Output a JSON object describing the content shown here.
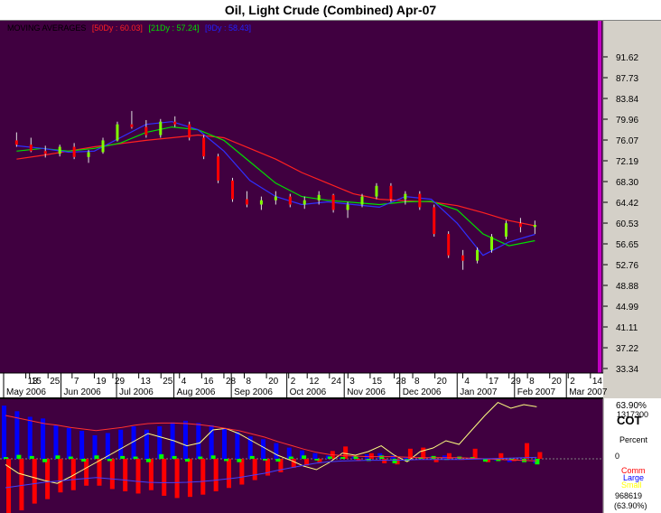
{
  "title": "Oil, Light Crude (Combined) Apr-07",
  "legend": {
    "label": "MOVING AVERAGES",
    "ma50": "[50Dy : 60.03]",
    "ma21": "[21Dy : 57.24]",
    "ma9": "[9Dy : 58.43]"
  },
  "colors": {
    "background": "#400040",
    "up_candle": "#80ff00",
    "down_candle": "#ff0000",
    "ma50": "#ff2020",
    "ma21": "#00e000",
    "ma9": "#3030ff",
    "cot_line": "#ffff80",
    "cot_bar_pos": "#0000ff",
    "cot_bar_neg": "#ff0000",
    "cot_bar_small": "#00ff00"
  },
  "x_ticks": [
    "13",
    "15",
    "25",
    "7",
    "19",
    "29",
    "13",
    "25",
    "4",
    "16",
    "28",
    "8",
    "20",
    "2",
    "12",
    "24",
    "3",
    "15",
    "28",
    "8",
    "20",
    "4",
    "17",
    "29",
    "8",
    "20",
    "2",
    "14"
  ],
  "month_labels": [
    "May 2006",
    "Jun 2006",
    "Jul 2006",
    "Aug 2006",
    "Sep 2006",
    "Oct 2006",
    "Nov 2006",
    "Dec 2006",
    "Jan 2007",
    "Feb 2007",
    "Mar 2007"
  ],
  "lower_panel": {
    "top_pct": "63.90%",
    "top_value": "1317300",
    "name": "COT",
    "unit": "Percent",
    "zero_label": "0",
    "legend_comm": "Comm",
    "legend_large": "Large",
    "legend_small": "Small",
    "bottom_value": "968619",
    "bottom_pct": "(63.90%)"
  },
  "chart_data": {
    "type": "line",
    "title": "Oil, Light Crude (Combined) Apr-07",
    "ylim": [
      33.34,
      95.5
    ],
    "y_ticks": [
      "91.62",
      "87.73",
      "83.84",
      "79.96",
      "76.07",
      "72.19",
      "68.30",
      "64.42",
      "60.53",
      "56.65",
      "52.76",
      "48.88",
      "44.99",
      "41.11",
      "37.22",
      "33.34"
    ],
    "x": [
      "2006-05-08",
      "2006-05-22",
      "2006-06-05",
      "2006-06-19",
      "2006-07-03",
      "2006-07-17",
      "2006-07-31",
      "2006-08-14",
      "2006-08-28",
      "2006-09-11",
      "2006-09-25",
      "2006-10-09",
      "2006-10-23",
      "2006-11-06",
      "2006-11-20",
      "2006-12-04",
      "2006-12-18",
      "2007-01-01",
      "2007-01-15",
      "2007-01-29",
      "2007-02-12"
    ],
    "series": [
      {
        "name": "50Dy",
        "values": [
          72.5,
          73.2,
          74.0,
          74.8,
          75.4,
          76.0,
          76.5,
          77.0,
          76.5,
          74.5,
          72.5,
          70.0,
          68.0,
          66.0,
          65.0,
          64.7,
          64.5,
          63.8,
          62.5,
          61.0,
          60.03
        ]
      },
      {
        "name": "21Dy",
        "values": [
          74.0,
          74.5,
          74.0,
          74.5,
          75.5,
          77.5,
          78.5,
          78.0,
          76.0,
          72.0,
          68.0,
          65.5,
          64.8,
          64.4,
          64.0,
          64.5,
          64.6,
          63.0,
          58.5,
          56.3,
          57.24
        ]
      },
      {
        "name": "9Dy",
        "values": [
          75.0,
          74.5,
          73.8,
          74.0,
          76.5,
          79.0,
          79.5,
          78.0,
          74.0,
          68.5,
          65.5,
          64.0,
          64.5,
          64.0,
          63.5,
          65.5,
          65.0,
          60.5,
          54.5,
          57.0,
          58.43
        ]
      }
    ],
    "ohlc": [
      [
        76.0,
        77.5,
        74.8,
        75.2
      ],
      [
        75.2,
        76.5,
        73.8,
        74.0
      ],
      [
        74.0,
        75.0,
        72.8,
        73.5
      ],
      [
        73.5,
        75.2,
        73.0,
        74.8
      ],
      [
        74.8,
        75.5,
        72.5,
        72.9
      ],
      [
        72.9,
        74.2,
        71.8,
        73.8
      ],
      [
        73.8,
        76.5,
        73.5,
        76.0
      ],
      [
        76.0,
        79.5,
        75.8,
        79.0
      ],
      [
        79.0,
        81.5,
        78.2,
        78.5
      ],
      [
        78.5,
        79.8,
        76.5,
        77.0
      ],
      [
        77.0,
        80.0,
        76.5,
        79.5
      ],
      [
        79.5,
        80.5,
        78.5,
        79.0
      ],
      [
        79.0,
        79.5,
        76.0,
        76.5
      ],
      [
        76.5,
        77.0,
        72.5,
        73.0
      ],
      [
        73.0,
        73.5,
        68.0,
        68.5
      ],
      [
        68.5,
        69.0,
        64.5,
        65.0
      ],
      [
        65.0,
        66.5,
        63.5,
        64.0
      ],
      [
        64.0,
        65.5,
        63.0,
        64.8
      ],
      [
        64.8,
        66.5,
        64.0,
        65.5
      ],
      [
        65.5,
        66.0,
        63.5,
        64.0
      ],
      [
        64.0,
        65.5,
        63.2,
        64.8
      ],
      [
        64.8,
        66.5,
        64.0,
        65.8
      ],
      [
        65.8,
        66.0,
        62.5,
        63.0
      ],
      [
        63.0,
        64.5,
        61.5,
        64.0
      ],
      [
        64.0,
        66.0,
        63.5,
        65.5
      ],
      [
        65.5,
        68.0,
        65.0,
        67.5
      ],
      [
        67.5,
        68.0,
        64.5,
        65.0
      ],
      [
        65.0,
        66.5,
        64.0,
        66.0
      ],
      [
        66.0,
        66.5,
        63.0,
        63.5
      ],
      [
        63.5,
        64.0,
        58.0,
        58.5
      ],
      [
        58.5,
        59.0,
        54.0,
        54.5
      ],
      [
        54.5,
        55.5,
        51.8,
        53.5
      ],
      [
        53.5,
        56.0,
        53.0,
        55.5
      ],
      [
        55.5,
        58.5,
        55.0,
        58.0
      ],
      [
        58.0,
        61.0,
        57.5,
        60.5
      ],
      [
        60.5,
        61.5,
        58.8,
        59.8
      ],
      [
        59.8,
        61.0,
        58.5,
        60.2
      ]
    ],
    "x_axis_start": "2006-05-01",
    "x_axis_end": "2007-03-17",
    "lower": {
      "type": "bar",
      "x": [
        "2006-05-02",
        "2006-05-09",
        "2006-05-16",
        "2006-05-23",
        "2006-05-30",
        "2006-06-06",
        "2006-06-13",
        "2006-06-20",
        "2006-06-27",
        "2006-07-04",
        "2006-07-11",
        "2006-07-18",
        "2006-07-25",
        "2006-08-01",
        "2006-08-08",
        "2006-08-15",
        "2006-08-22",
        "2006-08-29",
        "2006-09-05",
        "2006-09-12",
        "2006-09-19",
        "2006-09-26",
        "2006-10-03",
        "2006-10-10",
        "2006-10-17",
        "2006-10-24",
        "2006-10-31",
        "2006-11-07",
        "2006-11-14",
        "2006-11-21",
        "2006-11-28",
        "2006-12-05",
        "2006-12-12",
        "2006-12-19",
        "2006-12-26",
        "2007-01-02",
        "2007-01-09",
        "2007-01-16",
        "2007-01-23",
        "2007-01-30",
        "2007-02-06",
        "2007-02-13"
      ],
      "large": [
        95,
        85,
        75,
        72,
        60,
        55,
        50,
        42,
        46,
        52,
        58,
        52,
        58,
        65,
        68,
        64,
        60,
        55,
        48,
        40,
        35,
        28,
        20,
        15,
        10,
        6,
        2,
        5,
        8,
        10,
        6,
        2,
        0,
        4,
        6,
        3,
        2,
        0,
        -3,
        -6,
        -4,
        -8
      ],
      "comm": [
        -98,
        -92,
        -80,
        -72,
        -60,
        -56,
        -48,
        -48,
        -54,
        -58,
        -62,
        -56,
        -66,
        -70,
        -68,
        -64,
        -58,
        -52,
        -46,
        -38,
        -30,
        -24,
        -16,
        -12,
        -6,
        14,
        22,
        -4,
        10,
        -8,
        -10,
        18,
        20,
        -6,
        10,
        -2,
        18,
        -6,
        10,
        -4,
        28,
        12
      ],
      "small": [
        3,
        7,
        5,
        -6,
        6,
        4,
        -5,
        6,
        -4,
        5,
        4,
        -6,
        8,
        5,
        -5,
        4,
        6,
        -4,
        -6,
        5,
        -3,
        -5,
        4,
        6,
        -3,
        4,
        3,
        5,
        -4,
        6,
        -8,
        -4,
        3,
        5,
        -2,
        4,
        3,
        -5,
        -4,
        -2,
        -6,
        -10
      ],
      "cot_pct": [
        -8,
        -20,
        -25,
        -30,
        -34,
        -25,
        -15,
        -5,
        5,
        15,
        25,
        35,
        30,
        25,
        18,
        22,
        40,
        42,
        35,
        25,
        15,
        5,
        -2,
        -10,
        -15,
        -5,
        8,
        5,
        10,
        18,
        5,
        -4,
        10,
        15,
        25,
        20,
        40,
        60,
        78,
        70,
        75,
        72
      ],
      "ma_line": [
        80,
        75,
        70,
        65,
        62,
        58,
        55,
        52,
        55,
        58,
        62,
        65,
        66,
        66,
        65,
        63,
        60,
        56,
        52,
        46,
        40,
        32,
        25,
        18,
        12,
        8,
        6,
        5,
        4,
        4,
        4,
        3,
        2,
        2,
        2,
        2,
        1,
        0,
        -1,
        -2,
        -3,
        -4
      ]
    }
  }
}
